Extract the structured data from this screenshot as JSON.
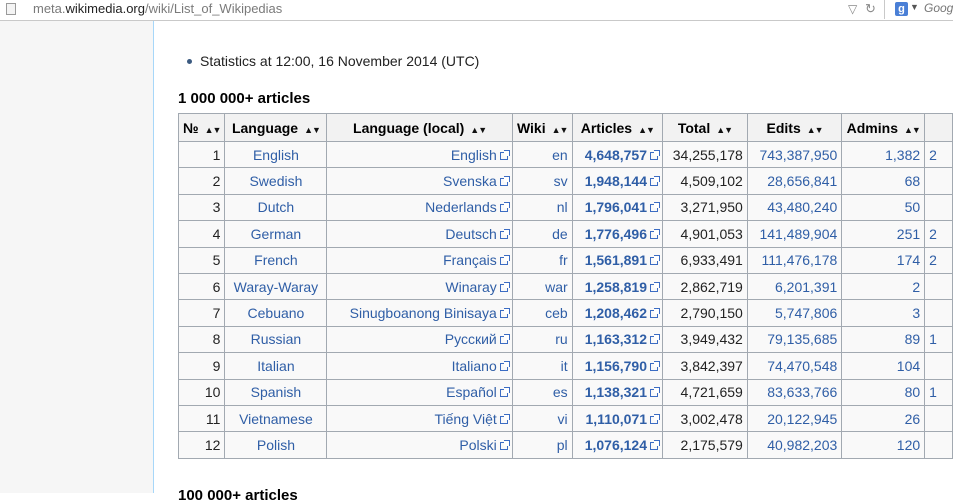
{
  "browser": {
    "url_domain_prefix": "meta.",
    "url_domain": "wikimedia.org",
    "url_path": "/wiki/List_of_Wikipedias",
    "search_placeholder": "Goog",
    "search_engine_badge": "g"
  },
  "stats_line": "Statistics at 12:00, 16 November 2014 (UTC)",
  "section_title": "1 000 000+ articles",
  "next_section_title": "100 000+ articles",
  "table": {
    "headers": [
      "№",
      "Language",
      "Language (local)",
      "Wiki",
      "Articles",
      "Total",
      "Edits",
      "Admins",
      ""
    ],
    "rows": [
      {
        "n": "1",
        "lang": "English",
        "local": "English",
        "wiki": "en",
        "articles": "4,648,757",
        "total": "34,255,178",
        "edits": "743,387,950",
        "admins": "1,382",
        "extra": "2"
      },
      {
        "n": "2",
        "lang": "Swedish",
        "local": "Svenska",
        "wiki": "sv",
        "articles": "1,948,144",
        "total": "4,509,102",
        "edits": "28,656,841",
        "admins": "68",
        "extra": ""
      },
      {
        "n": "3",
        "lang": "Dutch",
        "local": "Nederlands",
        "wiki": "nl",
        "articles": "1,796,041",
        "total": "3,271,950",
        "edits": "43,480,240",
        "admins": "50",
        "extra": ""
      },
      {
        "n": "4",
        "lang": "German",
        "local": "Deutsch",
        "wiki": "de",
        "articles": "1,776,496",
        "total": "4,901,053",
        "edits": "141,489,904",
        "admins": "251",
        "extra": "2"
      },
      {
        "n": "5",
        "lang": "French",
        "local": "Français",
        "wiki": "fr",
        "articles": "1,561,891",
        "total": "6,933,491",
        "edits": "111,476,178",
        "admins": "174",
        "extra": "2"
      },
      {
        "n": "6",
        "lang": "Waray-Waray",
        "local": "Winaray",
        "wiki": "war",
        "articles": "1,258,819",
        "total": "2,862,719",
        "edits": "6,201,391",
        "admins": "2",
        "extra": ""
      },
      {
        "n": "7",
        "lang": "Cebuano",
        "local": "Sinugboanong Binisaya",
        "wiki": "ceb",
        "articles": "1,208,462",
        "total": "2,790,150",
        "edits": "5,747,806",
        "admins": "3",
        "extra": ""
      },
      {
        "n": "8",
        "lang": "Russian",
        "local": "Русский",
        "wiki": "ru",
        "articles": "1,163,312",
        "total": "3,949,432",
        "edits": "79,135,685",
        "admins": "89",
        "extra": "1"
      },
      {
        "n": "9",
        "lang": "Italian",
        "local": "Italiano",
        "wiki": "it",
        "articles": "1,156,790",
        "total": "3,842,397",
        "edits": "74,470,548",
        "admins": "104",
        "extra": ""
      },
      {
        "n": "10",
        "lang": "Spanish",
        "local": "Español",
        "wiki": "es",
        "articles": "1,138,321",
        "total": "4,721,659",
        "edits": "83,633,766",
        "admins": "80",
        "extra": "1"
      },
      {
        "n": "11",
        "lang": "Vietnamese",
        "local": "Tiếng Việt",
        "wiki": "vi",
        "articles": "1,110,071",
        "total": "3,002,478",
        "edits": "20,122,945",
        "admins": "26",
        "extra": ""
      },
      {
        "n": "12",
        "lang": "Polish",
        "local": "Polski",
        "wiki": "pl",
        "articles": "1,076,124",
        "total": "2,175,579",
        "edits": "40,982,203",
        "admins": "120",
        "extra": ""
      }
    ]
  },
  "colors": {
    "link": "#2f5ea6",
    "header_bg": "#f2f2f2",
    "cell_bg": "#f9f9f9",
    "border": "#a2a9b1"
  }
}
